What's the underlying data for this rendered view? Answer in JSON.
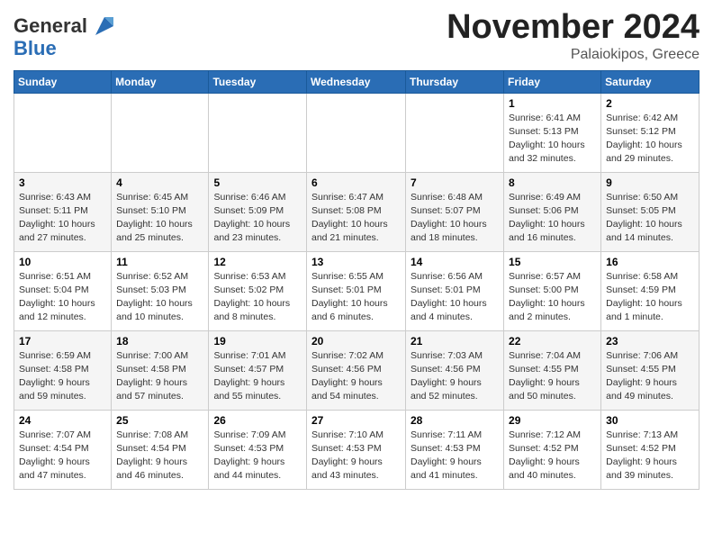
{
  "logo": {
    "general": "General",
    "blue": "Blue"
  },
  "header": {
    "month": "November 2024",
    "location": "Palaiokipos, Greece"
  },
  "weekdays": [
    "Sunday",
    "Monday",
    "Tuesday",
    "Wednesday",
    "Thursday",
    "Friday",
    "Saturday"
  ],
  "weeks": [
    [
      {
        "day": "",
        "info": ""
      },
      {
        "day": "",
        "info": ""
      },
      {
        "day": "",
        "info": ""
      },
      {
        "day": "",
        "info": ""
      },
      {
        "day": "",
        "info": ""
      },
      {
        "day": "1",
        "info": "Sunrise: 6:41 AM\nSunset: 5:13 PM\nDaylight: 10 hours\nand 32 minutes."
      },
      {
        "day": "2",
        "info": "Sunrise: 6:42 AM\nSunset: 5:12 PM\nDaylight: 10 hours\nand 29 minutes."
      }
    ],
    [
      {
        "day": "3",
        "info": "Sunrise: 6:43 AM\nSunset: 5:11 PM\nDaylight: 10 hours\nand 27 minutes."
      },
      {
        "day": "4",
        "info": "Sunrise: 6:45 AM\nSunset: 5:10 PM\nDaylight: 10 hours\nand 25 minutes."
      },
      {
        "day": "5",
        "info": "Sunrise: 6:46 AM\nSunset: 5:09 PM\nDaylight: 10 hours\nand 23 minutes."
      },
      {
        "day": "6",
        "info": "Sunrise: 6:47 AM\nSunset: 5:08 PM\nDaylight: 10 hours\nand 21 minutes."
      },
      {
        "day": "7",
        "info": "Sunrise: 6:48 AM\nSunset: 5:07 PM\nDaylight: 10 hours\nand 18 minutes."
      },
      {
        "day": "8",
        "info": "Sunrise: 6:49 AM\nSunset: 5:06 PM\nDaylight: 10 hours\nand 16 minutes."
      },
      {
        "day": "9",
        "info": "Sunrise: 6:50 AM\nSunset: 5:05 PM\nDaylight: 10 hours\nand 14 minutes."
      }
    ],
    [
      {
        "day": "10",
        "info": "Sunrise: 6:51 AM\nSunset: 5:04 PM\nDaylight: 10 hours\nand 12 minutes."
      },
      {
        "day": "11",
        "info": "Sunrise: 6:52 AM\nSunset: 5:03 PM\nDaylight: 10 hours\nand 10 minutes."
      },
      {
        "day": "12",
        "info": "Sunrise: 6:53 AM\nSunset: 5:02 PM\nDaylight: 10 hours\nand 8 minutes."
      },
      {
        "day": "13",
        "info": "Sunrise: 6:55 AM\nSunset: 5:01 PM\nDaylight: 10 hours\nand 6 minutes."
      },
      {
        "day": "14",
        "info": "Sunrise: 6:56 AM\nSunset: 5:01 PM\nDaylight: 10 hours\nand 4 minutes."
      },
      {
        "day": "15",
        "info": "Sunrise: 6:57 AM\nSunset: 5:00 PM\nDaylight: 10 hours\nand 2 minutes."
      },
      {
        "day": "16",
        "info": "Sunrise: 6:58 AM\nSunset: 4:59 PM\nDaylight: 10 hours\nand 1 minute."
      }
    ],
    [
      {
        "day": "17",
        "info": "Sunrise: 6:59 AM\nSunset: 4:58 PM\nDaylight: 9 hours\nand 59 minutes."
      },
      {
        "day": "18",
        "info": "Sunrise: 7:00 AM\nSunset: 4:58 PM\nDaylight: 9 hours\nand 57 minutes."
      },
      {
        "day": "19",
        "info": "Sunrise: 7:01 AM\nSunset: 4:57 PM\nDaylight: 9 hours\nand 55 minutes."
      },
      {
        "day": "20",
        "info": "Sunrise: 7:02 AM\nSunset: 4:56 PM\nDaylight: 9 hours\nand 54 minutes."
      },
      {
        "day": "21",
        "info": "Sunrise: 7:03 AM\nSunset: 4:56 PM\nDaylight: 9 hours\nand 52 minutes."
      },
      {
        "day": "22",
        "info": "Sunrise: 7:04 AM\nSunset: 4:55 PM\nDaylight: 9 hours\nand 50 minutes."
      },
      {
        "day": "23",
        "info": "Sunrise: 7:06 AM\nSunset: 4:55 PM\nDaylight: 9 hours\nand 49 minutes."
      }
    ],
    [
      {
        "day": "24",
        "info": "Sunrise: 7:07 AM\nSunset: 4:54 PM\nDaylight: 9 hours\nand 47 minutes."
      },
      {
        "day": "25",
        "info": "Sunrise: 7:08 AM\nSunset: 4:54 PM\nDaylight: 9 hours\nand 46 minutes."
      },
      {
        "day": "26",
        "info": "Sunrise: 7:09 AM\nSunset: 4:53 PM\nDaylight: 9 hours\nand 44 minutes."
      },
      {
        "day": "27",
        "info": "Sunrise: 7:10 AM\nSunset: 4:53 PM\nDaylight: 9 hours\nand 43 minutes."
      },
      {
        "day": "28",
        "info": "Sunrise: 7:11 AM\nSunset: 4:53 PM\nDaylight: 9 hours\nand 41 minutes."
      },
      {
        "day": "29",
        "info": "Sunrise: 7:12 AM\nSunset: 4:52 PM\nDaylight: 9 hours\nand 40 minutes."
      },
      {
        "day": "30",
        "info": "Sunrise: 7:13 AM\nSunset: 4:52 PM\nDaylight: 9 hours\nand 39 minutes."
      }
    ]
  ]
}
